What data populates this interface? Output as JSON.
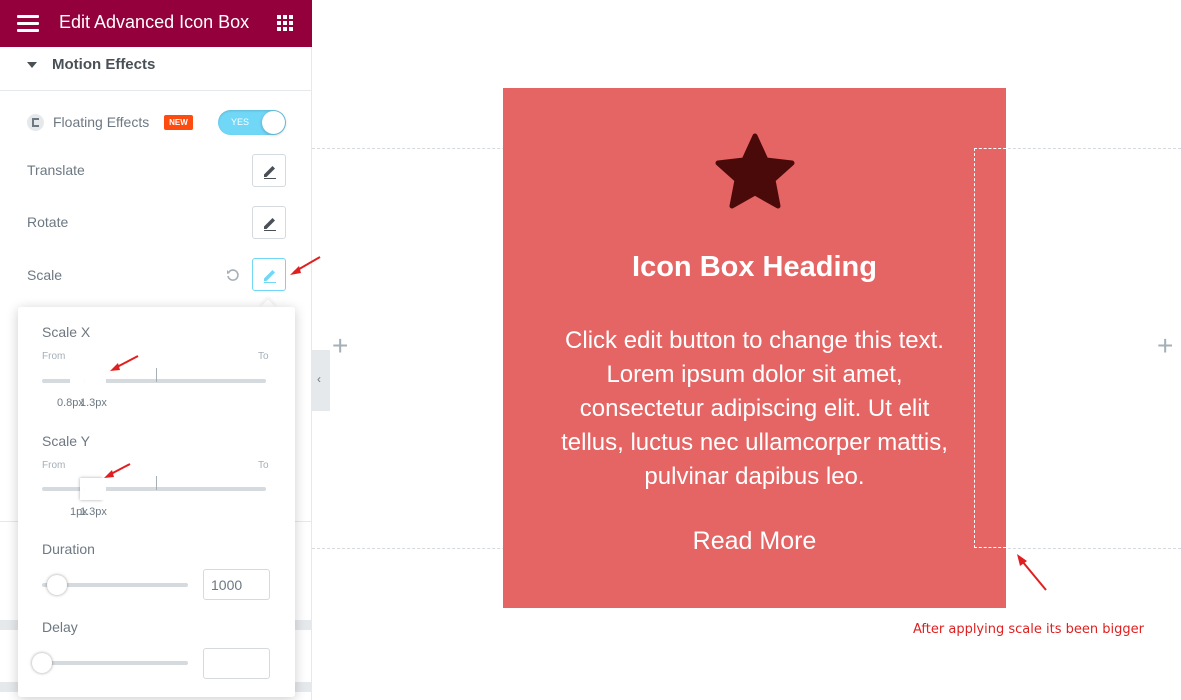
{
  "header": {
    "title": "Edit Advanced Icon Box",
    "bg_color": "#93003c"
  },
  "section": {
    "title": "Motion Effects"
  },
  "controls": {
    "floating_effects_label": "Floating Effects",
    "new_badge": "NEW",
    "toggle_label": "YES",
    "translate_label": "Translate",
    "rotate_label": "Rotate",
    "scale_label": "Scale"
  },
  "popover": {
    "scale_x": {
      "label": "Scale X",
      "from": "From",
      "to": "To",
      "value_from": "0.8px",
      "value_to": "1.3px"
    },
    "scale_y": {
      "label": "Scale Y",
      "from": "From",
      "to": "To",
      "value_from": "1px",
      "value_to": "1.3px"
    },
    "duration": {
      "label": "Duration",
      "value": "1000"
    },
    "delay": {
      "label": "Delay",
      "value": ""
    }
  },
  "icon_box": {
    "heading": "Icon Box Heading",
    "text": "Click edit button to change this text. Lorem ipsum dolor sit amet, consectetur adipiscing elit. Ut elit tellus, luctus nec ullamcorper mattis, pulvinar dapibus leo.",
    "read_more": "Read More",
    "bg_color": "#e56464",
    "icon": "star-icon"
  },
  "annotation": "After applying scale its been bigger",
  "canvas": {
    "add_symbol": "+"
  }
}
